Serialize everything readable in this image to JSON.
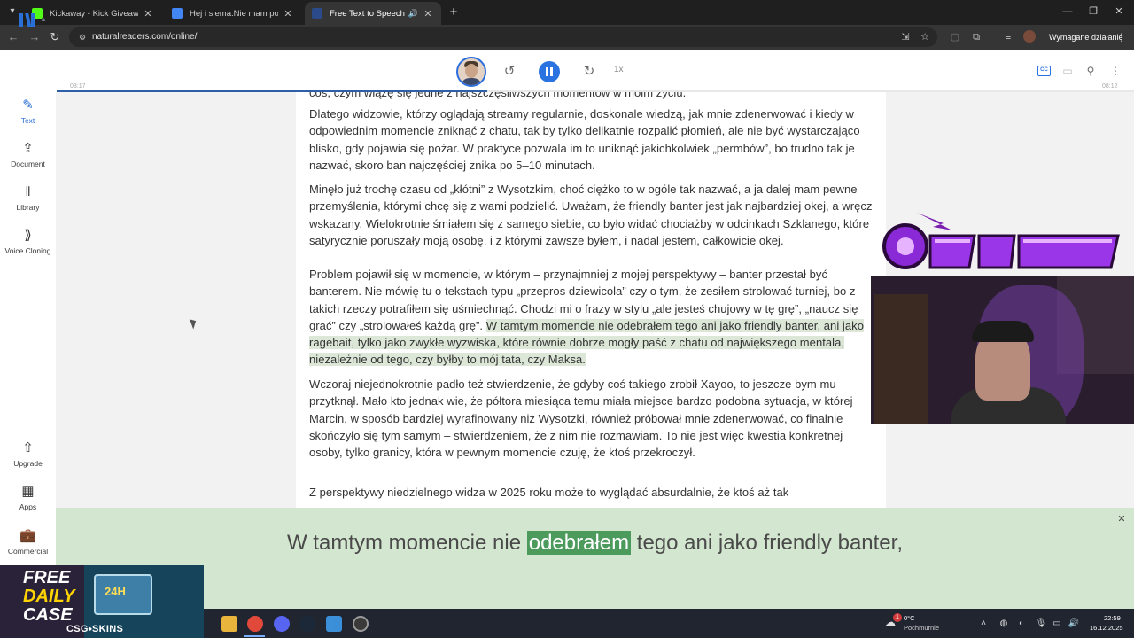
{
  "browser": {
    "tabs": [
      {
        "title": "Kickaway - Kick Giveaway Tool",
        "state": "inactive",
        "favicon_color": "#53fc18"
      },
      {
        "title": "Hej i siema.Nie mam pojęcia, k",
        "state": "inactive",
        "favicon_color": "#4285f4"
      },
      {
        "title": "Free Text to Speech Online",
        "state": "active",
        "favicon_color": "#2a4a8a"
      }
    ],
    "url": "naturalreaders.com/online/",
    "action_required_label": "Wymagane działanie"
  },
  "player": {
    "elapsed": "03:17",
    "total": "08:12",
    "speed": "1x",
    "progress_fraction": 0.4
  },
  "sidebar": {
    "top_items": [
      {
        "label": "Text",
        "icon": "pencil-icon",
        "active": true
      },
      {
        "label": "Document",
        "icon": "upload-icon",
        "active": false
      },
      {
        "label": "Library",
        "icon": "library-icon",
        "active": false
      },
      {
        "label": "Voice Cloning",
        "icon": "voice-cloning-icon",
        "active": false
      }
    ],
    "bottom_items": [
      {
        "label": "Upgrade",
        "icon": "upgrade-icon"
      },
      {
        "label": "Apps",
        "icon": "apps-icon"
      },
      {
        "label": "Commercial",
        "icon": "briefcase-icon"
      }
    ]
  },
  "document": {
    "partial_top": "coś, czym wiążę się jedne z najszczęśliwszych momentów w moim życiu.",
    "para1": "Dlatego widzowie, którzy oglądają streamy regularnie, doskonale wiedzą, jak mnie zdenerwować i kiedy w odpowiednim momencie zniknąć z chatu, tak by tylko delikatnie rozpalić płomień, ale nie być wystarczająco blisko, gdy pojawia się pożar. W praktyce pozwala im to uniknąć jakichkolwiek „permbów”, bo trudno tak je nazwać, skoro ban najczęściej znika po 5–10 minutach.",
    "para2": "Minęło już trochę czasu od „kłótni” z Wysotzkim, choć ciężko to w ogóle tak nazwać, a ja dalej mam pewne przemyślenia, którymi chcę się z wami podzielić. Uważam, że friendly banter jest jak najbardziej okej, a wręcz wskazany. Wielokrotnie śmiałem się z samego siebie, co było widać chociażby w odcinkach Szklanego, które satyrycznie poruszały moją osobę, i z którymi zawsze byłem, i nadal jestem, całkowicie okej.",
    "para3_plain": "Problem pojawił się w momencie, w którym – przynajmniej z mojej perspektywy – banter przestał być banterem. Nie mówię tu o tekstach typu „przepros dziewicola” czy o tym, że zesiłem strolować turniej, bo z takich rzeczy potrafiłem się uśmiechnąć. Chodzi mi o frazy w stylu „ale jesteś chujowy w tę grę”, „naucz się grać” czy „strolowałeś każdą grę”.",
    "para3_highlight": "W tamtym momencie nie odebrałem tego ani jako friendly banter, ani jako ragebait, tylko jako zwykłe wyzwiska, które równie dobrze mogły paść z chatu od największego mentala, niezależnie od tego, czy byłby to mój tata, czy Maksa.",
    "para4": "Wczoraj niejednokrotnie padło też stwierdzenie, że gdyby coś takiego zrobił Xayoo, to jeszcze bym mu przytknął. Mało kto jednak wie, że półtora miesiąca temu miała miejsce bardzo podobna sytuacja, w której Marcin, w sposób bardziej wyrafinowany niż Wysotzki, również próbował mnie zdenerwować, co finalnie skończyło się tym samym – stwierdzeniem, że z nim nie rozmawiam. To nie jest więc kwestia konkretnej osoby, tylko granicy, która w pewnym momencie czuję, że ktoś przekroczył.",
    "para5_partial": "Z perspektywy niedzielnego widza w 2025 roku może to wyglądać absurdalnie, że ktoś aż tak"
  },
  "caption": {
    "before": "W tamtym momencie nie ",
    "current_word": "odebrałem",
    "after": " tego ani jako friendly banter,"
  },
  "taskbar": {
    "weather_badge": "1",
    "weather_temp": "0°C",
    "weather_desc": "Pochmurnie",
    "time": "22:59",
    "date": "16.12.2025"
  },
  "ad": {
    "line1": "FREE",
    "line2": "DAILY",
    "line3": "CASE",
    "chest_label": "24H",
    "brand": "CSG⬩SKINS"
  },
  "colors": {
    "accent": "#2a73e0",
    "highlight": "#dce7d8",
    "caption_bg": "#d3e6cf",
    "caption_word": "#4c9a5c"
  }
}
